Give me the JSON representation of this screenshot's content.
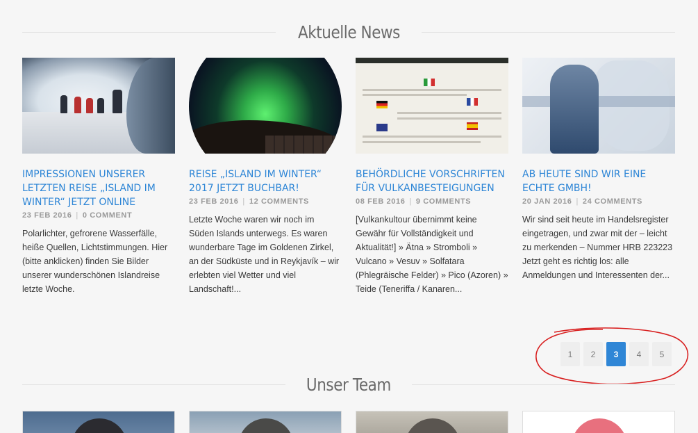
{
  "news": {
    "heading": "Aktuelle News",
    "posts": [
      {
        "title": "IMPRESSIONEN UNSERER LETZTEN REISE „ISLAND IM WINTER“ JETZT ONLINE",
        "date": "23 FEB 2016",
        "comments": "0 COMMENT",
        "excerpt": "Polarlichter, gefrorene Wasserfälle, heiße Quellen, Lichtstimmungen. Hier (bitte anklicken) finden Sie Bilder unserer wunderschönen Islandreise letzte Woche."
      },
      {
        "title": "REISE „ISLAND IM WINTER“ 2017 JETZT BUCHBAR!",
        "date": "23 FEB 2016",
        "comments": "12 COMMENTS",
        "excerpt": "Letzte Woche waren wir noch im Süden Islands unterwegs. Es waren wunderbare Tage im Goldenen Zirkel, an der Südküste und in Reykjavík – wir erlebten viel Wetter und viel Landschaft!..."
      },
      {
        "title": "BEHÖRDLICHE VORSCHRIFTEN FÜR VULKANBESTEIGUNGEN",
        "date": "08 FEB 2016",
        "comments": "9 COMMENTS",
        "excerpt": "[Vulkankultour übernimmt keine Gewähr für Vollständigkeit und Aktualität!] » Ätna » Stromboli » Vulcano » Vesuv » Solfatara (Phlegräische Felder) » Pico (Azoren) » Teide (Teneriffa / Kanaren..."
      },
      {
        "title": "AB HEUTE SIND WIR EINE ECHTE GMBH!",
        "date": "20 JAN 2016",
        "comments": "24 COMMENTS",
        "excerpt": "Wir sind seit heute im Handelsregister eingetragen, und zwar mit der – leicht zu merkenden – Nummer HRB 223223   Jetzt geht es richtig los: alle Anmeldungen und Interessenten der..."
      }
    ]
  },
  "pagination": {
    "pages": [
      "1",
      "2",
      "3",
      "4",
      "5"
    ],
    "current": "3"
  },
  "team": {
    "heading": "Unser Team"
  },
  "colors": {
    "accent": "#2f86d6",
    "annotation": "#d82020"
  }
}
